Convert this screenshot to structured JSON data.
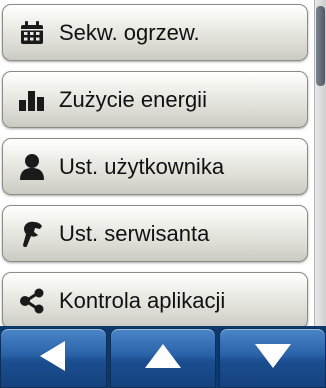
{
  "menu": {
    "items": [
      {
        "label": "Sekw. ogrzew.",
        "icon": "calendar-icon"
      },
      {
        "label": "Zużycie energii",
        "icon": "bar-chart-icon"
      },
      {
        "label": "Ust. użytkownika",
        "icon": "user-icon"
      },
      {
        "label": "Ust. serwisanta",
        "icon": "wrench-icon"
      },
      {
        "label": "Kontrola aplikacji",
        "icon": "share-icon"
      }
    ]
  },
  "navbar": {
    "buttons": [
      {
        "name": "back",
        "icon": "triangle-left-icon"
      },
      {
        "name": "up",
        "icon": "triangle-up-icon"
      },
      {
        "name": "down",
        "icon": "triangle-down-icon"
      }
    ]
  },
  "colors": {
    "nav_button": "#2a62a8",
    "menu_button": "#dcdcd5",
    "icon": "#1a1a1a"
  }
}
